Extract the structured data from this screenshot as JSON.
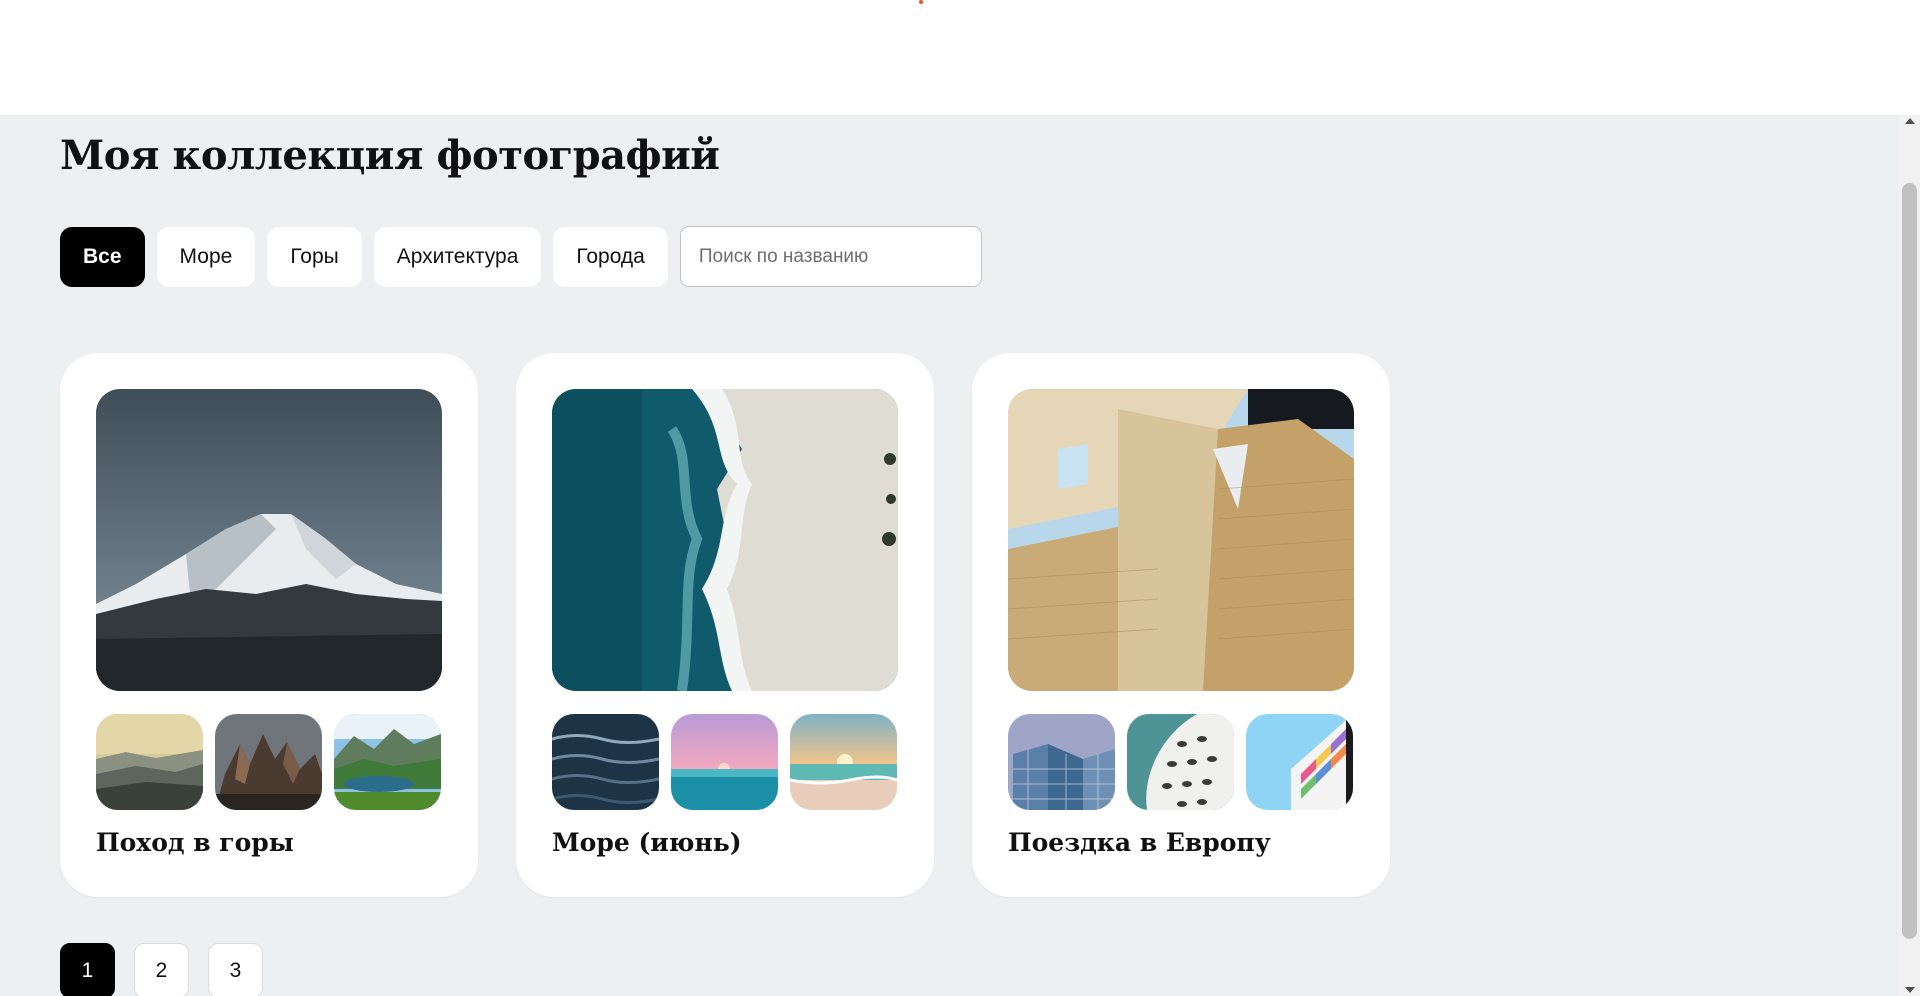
{
  "page": {
    "title": "Моя коллекция фотографий"
  },
  "filters": {
    "items": [
      {
        "label": "Все",
        "active": true
      },
      {
        "label": "Море",
        "active": false
      },
      {
        "label": "Горы",
        "active": false
      },
      {
        "label": "Архитектура",
        "active": false
      },
      {
        "label": "Города",
        "active": false
      }
    ],
    "search_placeholder": "Поиск по названию",
    "search_value": ""
  },
  "albums": [
    {
      "title": "Поход в горы",
      "main_image": "snow-capped-mountain-photo",
      "thumbnails": [
        "misty-hills-photo",
        "rocky-peaks-photo",
        "mountain-lake-photo"
      ]
    },
    {
      "title": "Море (июнь)",
      "main_image": "aerial-beach-waves-photo",
      "thumbnails": [
        "dark-water-ripples-photo",
        "pink-sunset-sea-photo",
        "beach-sunrise-photo"
      ]
    },
    {
      "title": "Поездка в Европу",
      "main_image": "modern-building-facade-photo",
      "thumbnails": [
        "glass-skyscraper-photo",
        "white-curved-building-photo",
        "colorful-facade-photo"
      ]
    }
  ],
  "pagination": {
    "pages": [
      "1",
      "2",
      "3"
    ],
    "current": "1"
  },
  "colors": {
    "page_background": "#eeeff1",
    "active_filter": "#000000",
    "card_background": "#ffffff"
  }
}
